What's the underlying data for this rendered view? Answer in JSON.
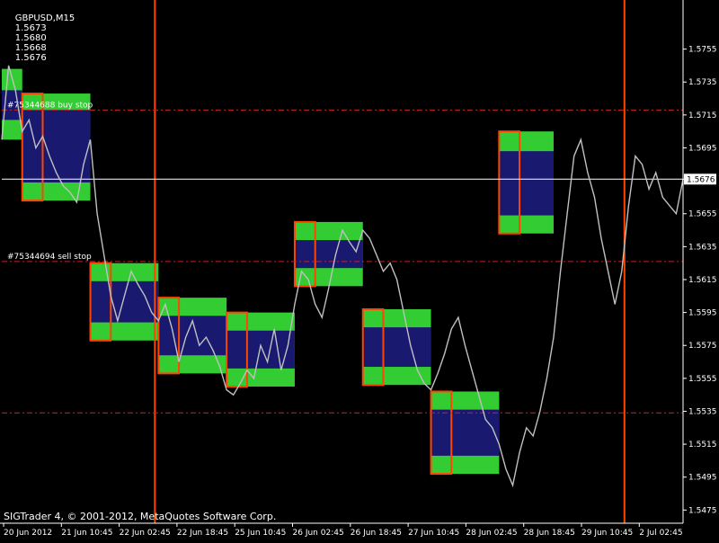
{
  "header": {
    "symbol_timeframe": "GBPUSD,M15",
    "ohlc": [
      "1.5673",
      "1.5680",
      "1.5668",
      "1.5676"
    ]
  },
  "footer": {
    "copyright": "SIGTrader 4, © 2001-2012, MetaQuotes Software Corp."
  },
  "colors": {
    "background": "#000000",
    "price_line": "#c0c0c0",
    "zone_green": "#33cc33",
    "zone_navy": "#191970",
    "box_border": "#ff4500",
    "vline": "#ff4500",
    "order_line": "#cc2222",
    "bid_line": "#ffffff",
    "axis": "#ffffff"
  },
  "orders": [
    {
      "label": "#75344688 buy stop",
      "price": 1.5718
    },
    {
      "label": "#75344694 sell stop",
      "price": 1.5626
    }
  ],
  "levels": [
    1.5534
  ],
  "current_price": "1.5676",
  "chart_data": {
    "type": "line",
    "symbol": "GBPUSD",
    "timeframe": "M15",
    "y_ticks": [
      "1.5755",
      "1.5735",
      "1.5715",
      "1.5695",
      "1.5676",
      "1.5655",
      "1.5635",
      "1.5615",
      "1.5595",
      "1.5575",
      "1.5555",
      "1.5535",
      "1.5515",
      "1.5495",
      "1.5475"
    ],
    "x_ticks": [
      "20 Jun 2012",
      "21 Jun 10:45",
      "22 Jun 02:45",
      "22 Jun 18:45",
      "25 Jun 10:45",
      "26 Jun 02:45",
      "26 Jun 18:45",
      "27 Jun 10:45",
      "28 Jun 02:45",
      "28 Jun 18:45",
      "29 Jun 10:45",
      "2 Jul 02:45"
    ],
    "ylim": [
      1.5467,
      1.5775
    ],
    "price_series": [
      [
        0,
        1.57
      ],
      [
        1,
        1.5745
      ],
      [
        2,
        1.573
      ],
      [
        3,
        1.5705
      ],
      [
        4,
        1.5712
      ],
      [
        5,
        1.5695
      ],
      [
        6,
        1.5702
      ],
      [
        7,
        1.569
      ],
      [
        8,
        1.568
      ],
      [
        9,
        1.5672
      ],
      [
        10,
        1.5668
      ],
      [
        11,
        1.5662
      ],
      [
        12,
        1.5685
      ],
      [
        13,
        1.57
      ],
      [
        14,
        1.5655
      ],
      [
        15,
        1.563
      ],
      [
        16,
        1.5605
      ],
      [
        17,
        1.559
      ],
      [
        18,
        1.5605
      ],
      [
        19,
        1.562
      ],
      [
        20,
        1.5612
      ],
      [
        21,
        1.5605
      ],
      [
        22,
        1.5595
      ],
      [
        23,
        1.559
      ],
      [
        24,
        1.56
      ],
      [
        25,
        1.5585
      ],
      [
        26,
        1.5565
      ],
      [
        27,
        1.558
      ],
      [
        28,
        1.559
      ],
      [
        29,
        1.5575
      ],
      [
        30,
        1.558
      ],
      [
        31,
        1.5572
      ],
      [
        32,
        1.5562
      ],
      [
        33,
        1.5548
      ],
      [
        34,
        1.5545
      ],
      [
        35,
        1.5552
      ],
      [
        36,
        1.556
      ],
      [
        37,
        1.5555
      ],
      [
        38,
        1.5575
      ],
      [
        39,
        1.5565
      ],
      [
        40,
        1.5585
      ],
      [
        41,
        1.556
      ],
      [
        42,
        1.5575
      ],
      [
        43,
        1.56
      ],
      [
        44,
        1.562
      ],
      [
        45,
        1.5615
      ],
      [
        46,
        1.56
      ],
      [
        47,
        1.5592
      ],
      [
        48,
        1.561
      ],
      [
        49,
        1.563
      ],
      [
        50,
        1.5645
      ],
      [
        51,
        1.5638
      ],
      [
        52,
        1.5632
      ],
      [
        53,
        1.5645
      ],
      [
        54,
        1.564
      ],
      [
        55,
        1.563
      ],
      [
        56,
        1.562
      ],
      [
        57,
        1.5625
      ],
      [
        58,
        1.5615
      ],
      [
        59,
        1.5595
      ],
      [
        60,
        1.5575
      ],
      [
        61,
        1.556
      ],
      [
        62,
        1.5552
      ],
      [
        63,
        1.5548
      ],
      [
        64,
        1.5558
      ],
      [
        65,
        1.557
      ],
      [
        66,
        1.5585
      ],
      [
        67,
        1.5592
      ],
      [
        68,
        1.5575
      ],
      [
        69,
        1.556
      ],
      [
        70,
        1.5545
      ],
      [
        71,
        1.553
      ],
      [
        72,
        1.5525
      ],
      [
        73,
        1.5515
      ],
      [
        74,
        1.55
      ],
      [
        75,
        1.549
      ],
      [
        76,
        1.551
      ],
      [
        77,
        1.5525
      ],
      [
        78,
        1.552
      ],
      [
        79,
        1.5535
      ],
      [
        80,
        1.5555
      ],
      [
        81,
        1.558
      ],
      [
        82,
        1.562
      ],
      [
        83,
        1.5655
      ],
      [
        84,
        1.569
      ],
      [
        85,
        1.57
      ],
      [
        86,
        1.568
      ],
      [
        87,
        1.5665
      ],
      [
        88,
        1.564
      ],
      [
        89,
        1.562
      ],
      [
        90,
        1.56
      ],
      [
        91,
        1.562
      ],
      [
        92,
        1.566
      ],
      [
        93,
        1.569
      ],
      [
        94,
        1.5685
      ],
      [
        95,
        1.567
      ],
      [
        96,
        1.568
      ],
      [
        97,
        1.5665
      ],
      [
        98,
        1.566
      ],
      [
        99,
        1.5655
      ],
      [
        100,
        1.5676
      ]
    ],
    "zones": [
      {
        "x0": 0,
        "x1": 2,
        "top": 1.5743,
        "mid_top": 1.573,
        "mid_bot": 1.5712,
        "bottom": 1.57,
        "box_x0": null,
        "box_x1": null,
        "box_top": null,
        "box_bot": null
      },
      {
        "x0": 3,
        "x1": 12,
        "top": 1.5728,
        "mid_top": 1.5718,
        "mid_bot": 1.5674,
        "bottom": 1.5663,
        "box_x0": 3,
        "box_x1": 5,
        "box_top": 1.5728,
        "box_bot": 1.5663
      },
      {
        "x0": 13,
        "x1": 22,
        "top": 1.5625,
        "mid_top": 1.5614,
        "mid_bot": 1.5589,
        "bottom": 1.5578,
        "box_x0": 13,
        "box_x1": 15,
        "box_top": 1.5625,
        "box_bot": 1.5578
      },
      {
        "x0": 23,
        "x1": 32,
        "top": 1.5604,
        "mid_top": 1.5593,
        "mid_bot": 1.5569,
        "bottom": 1.5558,
        "box_x0": 23,
        "box_x1": 25,
        "box_top": 1.5604,
        "box_bot": 1.5558
      },
      {
        "x0": 33,
        "x1": 42,
        "top": 1.5595,
        "mid_top": 1.5584,
        "mid_bot": 1.5561,
        "bottom": 1.555,
        "box_x0": 33,
        "box_x1": 35,
        "box_top": 1.5595,
        "box_bot": 1.555
      },
      {
        "x0": 43,
        "x1": 52,
        "top": 1.565,
        "mid_top": 1.5639,
        "mid_bot": 1.5622,
        "bottom": 1.5611,
        "box_x0": 43,
        "box_x1": 45,
        "box_top": 1.565,
        "box_bot": 1.5611
      },
      {
        "x0": 53,
        "x1": 62,
        "top": 1.5597,
        "mid_top": 1.5586,
        "mid_bot": 1.5562,
        "bottom": 1.5551,
        "box_x0": 53,
        "box_x1": 55,
        "box_top": 1.5597,
        "box_bot": 1.5551
      },
      {
        "x0": 63,
        "x1": 72,
        "top": 1.5547,
        "mid_top": 1.5536,
        "mid_bot": 1.5508,
        "bottom": 1.5497,
        "box_x0": 63,
        "box_x1": 65,
        "box_top": 1.5547,
        "box_bot": 1.5497
      },
      {
        "x0": 73,
        "x1": 80,
        "top": 1.5705,
        "mid_top": 1.5693,
        "mid_bot": 1.5654,
        "bottom": 1.5643,
        "box_x0": 73,
        "box_x1": 75,
        "box_top": 1.5705,
        "box_bot": 1.5643
      }
    ],
    "vertical_markers": [
      "22 Jun 18:45",
      "2 Jul 02:45"
    ]
  }
}
